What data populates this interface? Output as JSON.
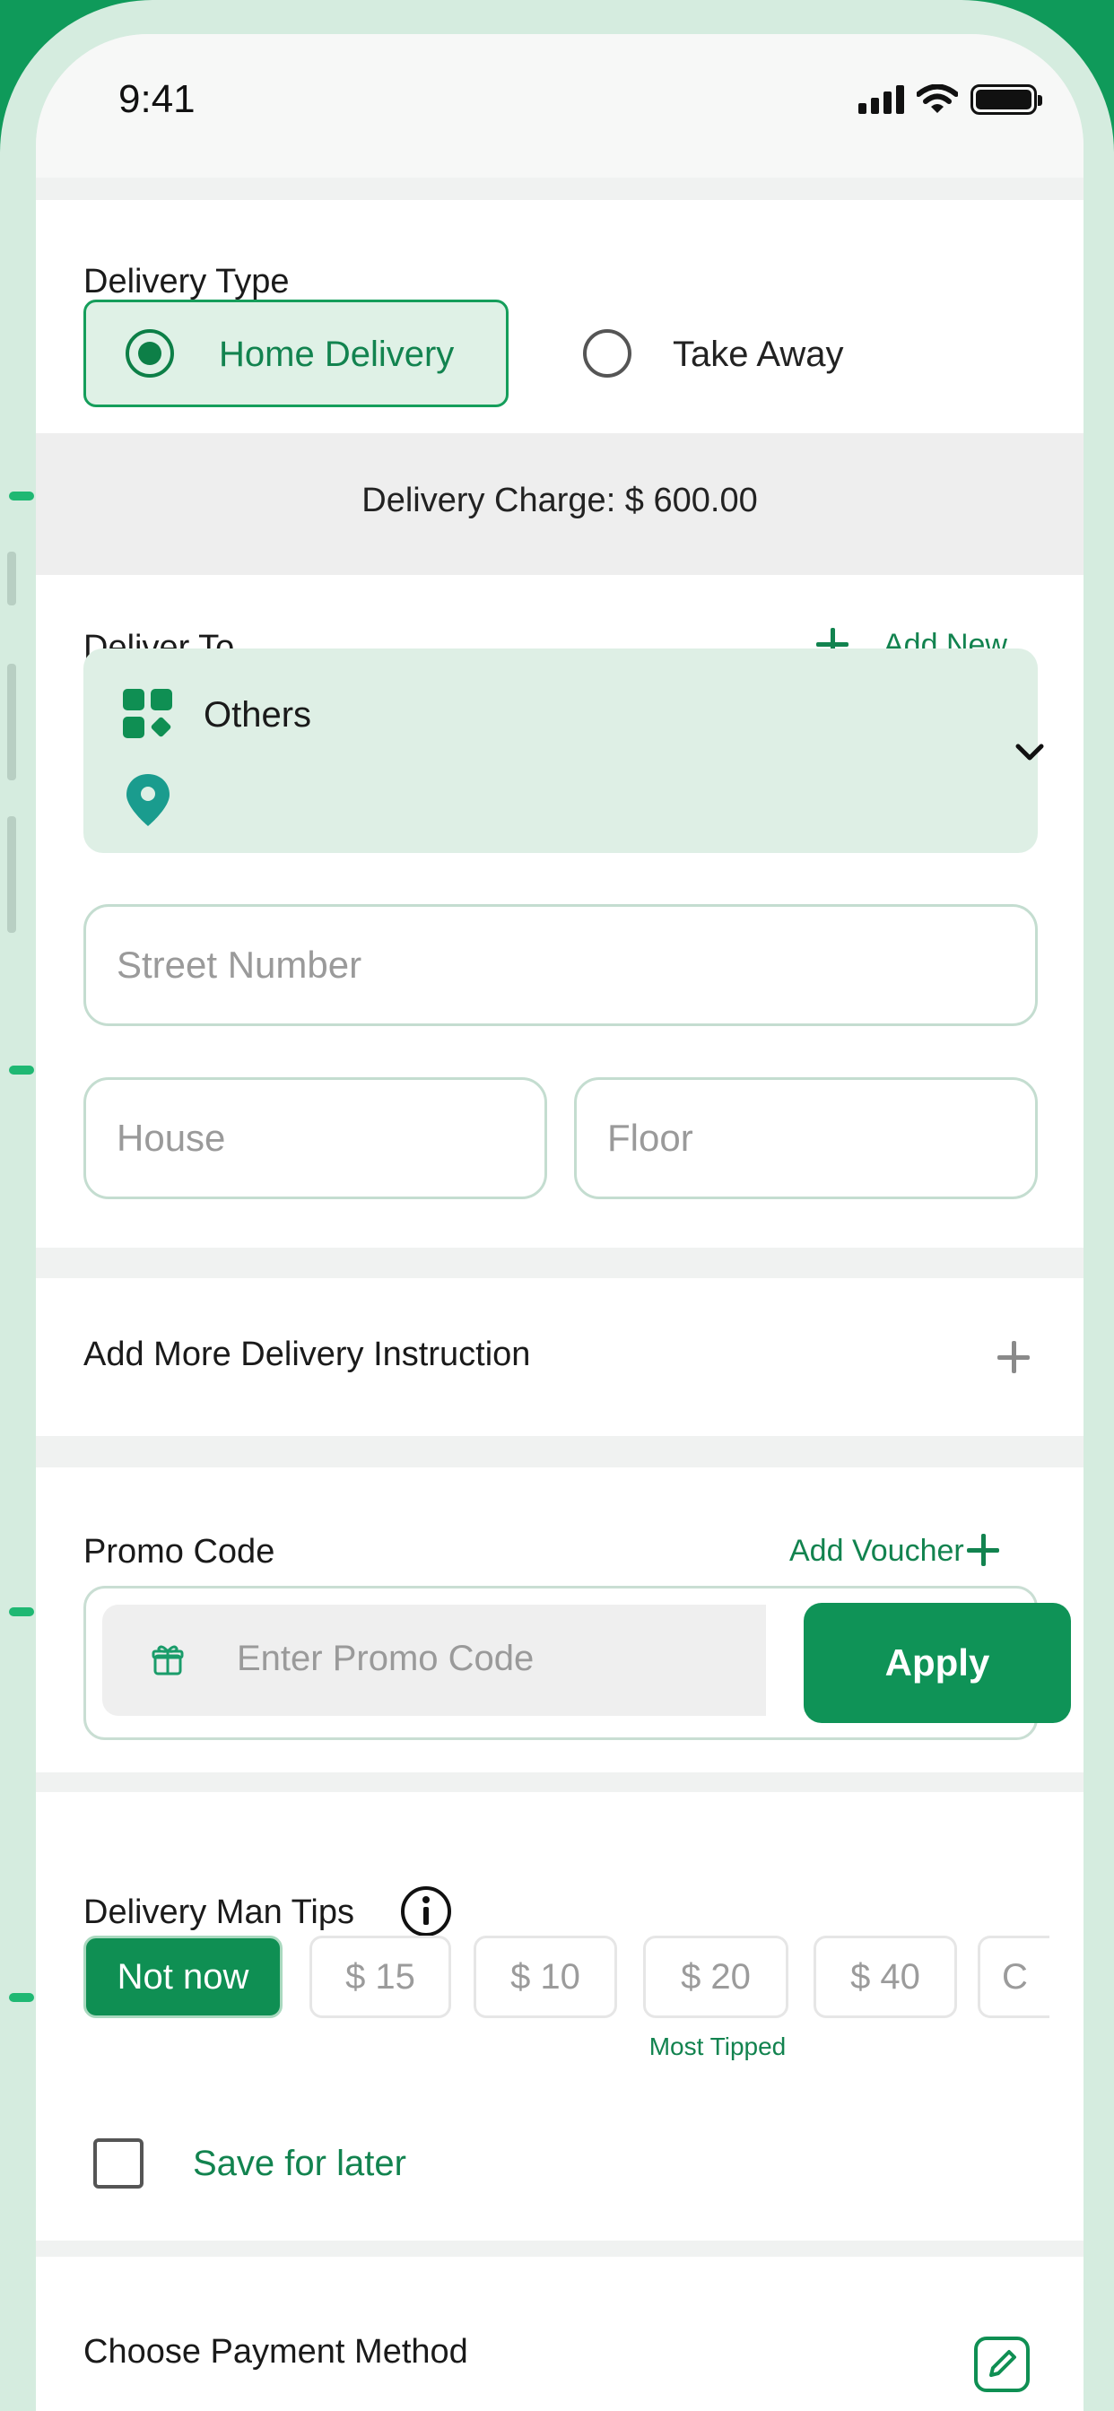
{
  "status_bar": {
    "time": "9:41"
  },
  "delivery_type": {
    "title": "Delivery Type",
    "options": [
      {
        "label": "Home Delivery",
        "selected": true
      },
      {
        "label": "Take Away",
        "selected": false
      }
    ],
    "charge_text": "Delivery Charge: $ 600.00"
  },
  "deliver_to": {
    "title": "Deliver To",
    "add_new_label": "Add New",
    "address_type": "Others",
    "icons": [
      "category-icon",
      "location-pin-icon",
      "chevron-down-icon"
    ]
  },
  "address_fields": {
    "street_placeholder": "Street Number",
    "house_placeholder": "House",
    "floor_placeholder": "Floor"
  },
  "instructions": {
    "label": "Add More Delivery Instruction"
  },
  "promo": {
    "title": "Promo Code",
    "add_voucher_label": "Add Voucher",
    "input_placeholder": "Enter Promo Code",
    "apply_label": "Apply"
  },
  "tips": {
    "title": "Delivery Man Tips",
    "options": [
      "Not now",
      "$ 15",
      "$ 10",
      "$ 20",
      "$ 40",
      "C"
    ],
    "selected_index": 0,
    "most_tipped_label": "Most Tipped",
    "save_for_later_label": "Save for later",
    "save_for_later_checked": false
  },
  "payment": {
    "title": "Choose Payment Method"
  },
  "colors": {
    "primary": "#0f9357",
    "primary_dark": "#0d7f47",
    "accent_text": "#12834f",
    "selected_bg": "#dff1e6",
    "pin": "#1a9c8e"
  }
}
